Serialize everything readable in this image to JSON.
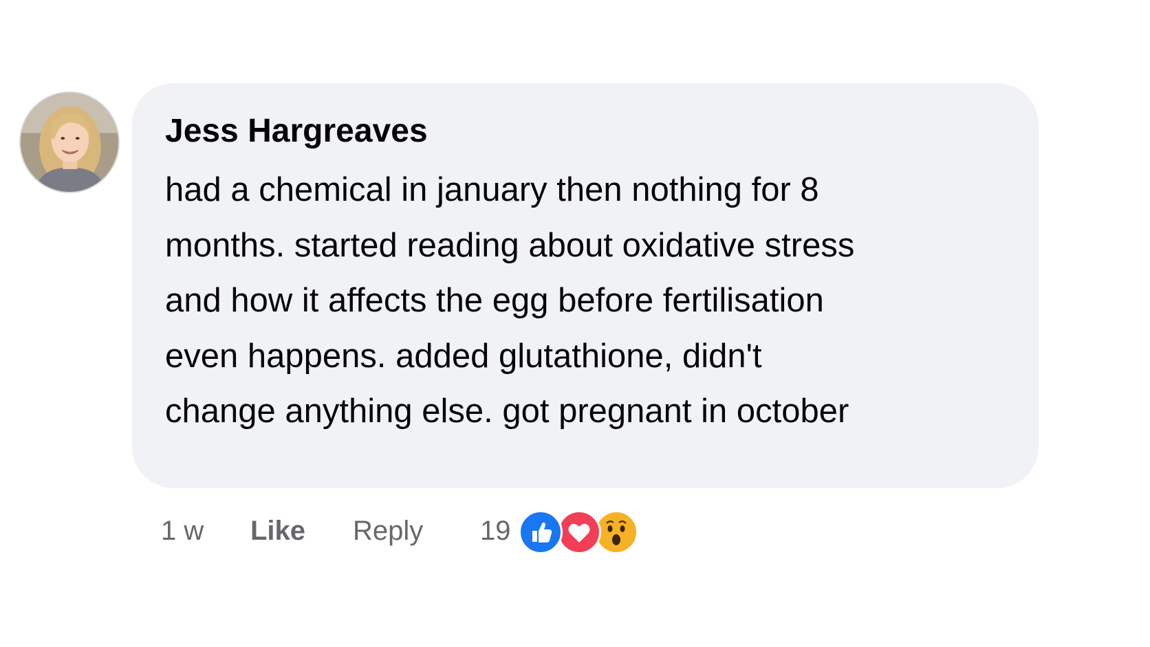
{
  "comment": {
    "author": "Jess Hargreaves",
    "lines": [
      "had a chemical in january then nothing for 8",
      "months. started reading about oxidative stress",
      "and how it affects the egg before fertilisation",
      "even happens. added glutathione, didn't",
      "change anything else. got pregnant in october"
    ],
    "timestamp": "1 w",
    "like_label": "Like",
    "reply_label": "Reply",
    "reaction_count": "19",
    "reactions": [
      "like-icon",
      "love-icon",
      "wow-icon"
    ]
  },
  "colors": {
    "bubble": "#f0f2f5",
    "meta_text": "#65676b",
    "like_blue": "#1877f2",
    "love_red": "#f33e58",
    "wow_yellow": "#f7b125"
  }
}
